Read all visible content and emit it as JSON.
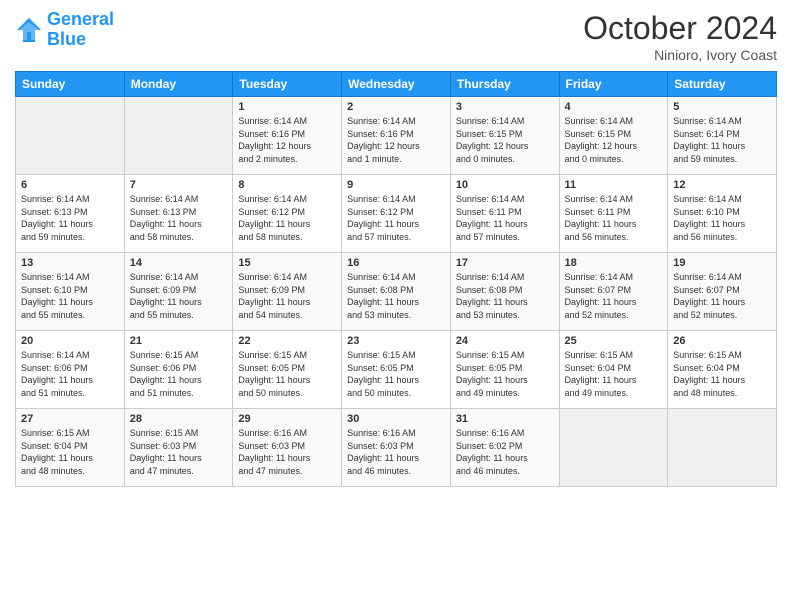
{
  "header": {
    "logo_line1": "General",
    "logo_line2": "Blue",
    "month_title": "October 2024",
    "subtitle": "Ninioro, Ivory Coast"
  },
  "days_of_week": [
    "Sunday",
    "Monday",
    "Tuesday",
    "Wednesday",
    "Thursday",
    "Friday",
    "Saturday"
  ],
  "weeks": [
    [
      {
        "num": "",
        "info": ""
      },
      {
        "num": "",
        "info": ""
      },
      {
        "num": "1",
        "info": "Sunrise: 6:14 AM\nSunset: 6:16 PM\nDaylight: 12 hours\nand 2 minutes."
      },
      {
        "num": "2",
        "info": "Sunrise: 6:14 AM\nSunset: 6:16 PM\nDaylight: 12 hours\nand 1 minute."
      },
      {
        "num": "3",
        "info": "Sunrise: 6:14 AM\nSunset: 6:15 PM\nDaylight: 12 hours\nand 0 minutes."
      },
      {
        "num": "4",
        "info": "Sunrise: 6:14 AM\nSunset: 6:15 PM\nDaylight: 12 hours\nand 0 minutes."
      },
      {
        "num": "5",
        "info": "Sunrise: 6:14 AM\nSunset: 6:14 PM\nDaylight: 11 hours\nand 59 minutes."
      }
    ],
    [
      {
        "num": "6",
        "info": "Sunrise: 6:14 AM\nSunset: 6:13 PM\nDaylight: 11 hours\nand 59 minutes."
      },
      {
        "num": "7",
        "info": "Sunrise: 6:14 AM\nSunset: 6:13 PM\nDaylight: 11 hours\nand 58 minutes."
      },
      {
        "num": "8",
        "info": "Sunrise: 6:14 AM\nSunset: 6:12 PM\nDaylight: 11 hours\nand 58 minutes."
      },
      {
        "num": "9",
        "info": "Sunrise: 6:14 AM\nSunset: 6:12 PM\nDaylight: 11 hours\nand 57 minutes."
      },
      {
        "num": "10",
        "info": "Sunrise: 6:14 AM\nSunset: 6:11 PM\nDaylight: 11 hours\nand 57 minutes."
      },
      {
        "num": "11",
        "info": "Sunrise: 6:14 AM\nSunset: 6:11 PM\nDaylight: 11 hours\nand 56 minutes."
      },
      {
        "num": "12",
        "info": "Sunrise: 6:14 AM\nSunset: 6:10 PM\nDaylight: 11 hours\nand 56 minutes."
      }
    ],
    [
      {
        "num": "13",
        "info": "Sunrise: 6:14 AM\nSunset: 6:10 PM\nDaylight: 11 hours\nand 55 minutes."
      },
      {
        "num": "14",
        "info": "Sunrise: 6:14 AM\nSunset: 6:09 PM\nDaylight: 11 hours\nand 55 minutes."
      },
      {
        "num": "15",
        "info": "Sunrise: 6:14 AM\nSunset: 6:09 PM\nDaylight: 11 hours\nand 54 minutes."
      },
      {
        "num": "16",
        "info": "Sunrise: 6:14 AM\nSunset: 6:08 PM\nDaylight: 11 hours\nand 53 minutes."
      },
      {
        "num": "17",
        "info": "Sunrise: 6:14 AM\nSunset: 6:08 PM\nDaylight: 11 hours\nand 53 minutes."
      },
      {
        "num": "18",
        "info": "Sunrise: 6:14 AM\nSunset: 6:07 PM\nDaylight: 11 hours\nand 52 minutes."
      },
      {
        "num": "19",
        "info": "Sunrise: 6:14 AM\nSunset: 6:07 PM\nDaylight: 11 hours\nand 52 minutes."
      }
    ],
    [
      {
        "num": "20",
        "info": "Sunrise: 6:14 AM\nSunset: 6:06 PM\nDaylight: 11 hours\nand 51 minutes."
      },
      {
        "num": "21",
        "info": "Sunrise: 6:15 AM\nSunset: 6:06 PM\nDaylight: 11 hours\nand 51 minutes."
      },
      {
        "num": "22",
        "info": "Sunrise: 6:15 AM\nSunset: 6:05 PM\nDaylight: 11 hours\nand 50 minutes."
      },
      {
        "num": "23",
        "info": "Sunrise: 6:15 AM\nSunset: 6:05 PM\nDaylight: 11 hours\nand 50 minutes."
      },
      {
        "num": "24",
        "info": "Sunrise: 6:15 AM\nSunset: 6:05 PM\nDaylight: 11 hours\nand 49 minutes."
      },
      {
        "num": "25",
        "info": "Sunrise: 6:15 AM\nSunset: 6:04 PM\nDaylight: 11 hours\nand 49 minutes."
      },
      {
        "num": "26",
        "info": "Sunrise: 6:15 AM\nSunset: 6:04 PM\nDaylight: 11 hours\nand 48 minutes."
      }
    ],
    [
      {
        "num": "27",
        "info": "Sunrise: 6:15 AM\nSunset: 6:04 PM\nDaylight: 11 hours\nand 48 minutes."
      },
      {
        "num": "28",
        "info": "Sunrise: 6:15 AM\nSunset: 6:03 PM\nDaylight: 11 hours\nand 47 minutes."
      },
      {
        "num": "29",
        "info": "Sunrise: 6:16 AM\nSunset: 6:03 PM\nDaylight: 11 hours\nand 47 minutes."
      },
      {
        "num": "30",
        "info": "Sunrise: 6:16 AM\nSunset: 6:03 PM\nDaylight: 11 hours\nand 46 minutes."
      },
      {
        "num": "31",
        "info": "Sunrise: 6:16 AM\nSunset: 6:02 PM\nDaylight: 11 hours\nand 46 minutes."
      },
      {
        "num": "",
        "info": ""
      },
      {
        "num": "",
        "info": ""
      }
    ]
  ]
}
